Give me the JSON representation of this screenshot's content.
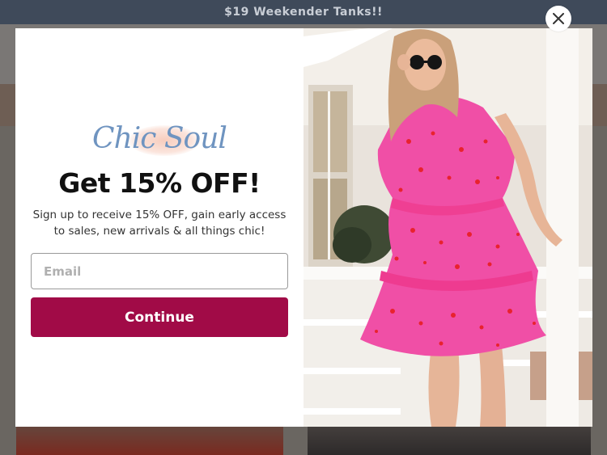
{
  "announcement": {
    "text": "$19 Weekender Tanks!!"
  },
  "popup": {
    "logo_text": "Chic Soul",
    "headline": "Get 15% OFF!",
    "subtext": "Sign up to receive 15% OFF, gain early access to sales, new arrivals & all things chic!",
    "email_placeholder": "Email",
    "email_value": "",
    "continue_label": "Continue",
    "accent_color": "#a10b47",
    "logo_color": "#6f94c0"
  },
  "icons": {
    "close": "close-icon"
  }
}
